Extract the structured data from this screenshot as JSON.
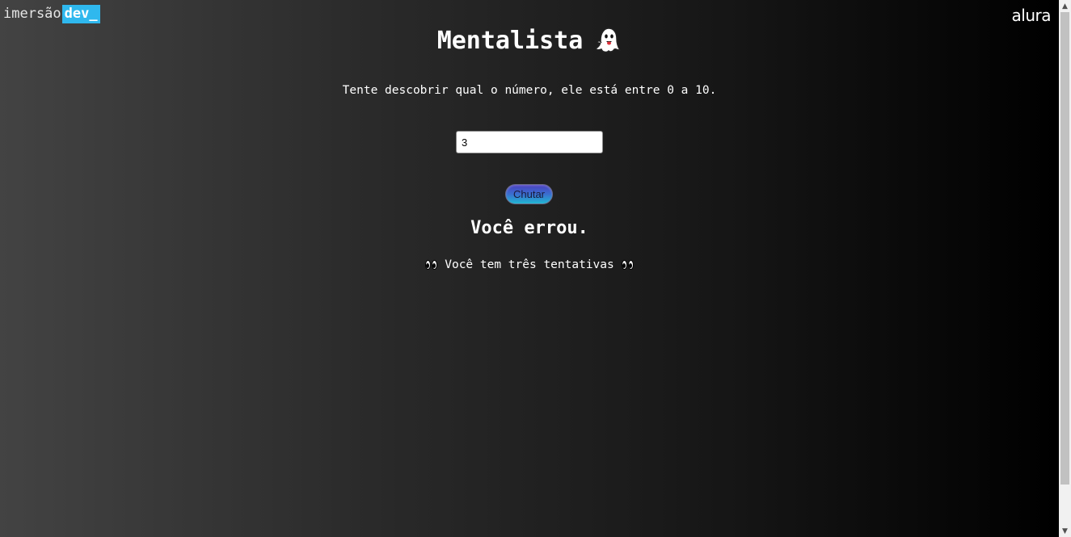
{
  "brand": {
    "imersao_text": "imersão",
    "dev_text": "dev_",
    "dev_color": "#2fb8ee",
    "alura_text": "alura"
  },
  "game": {
    "title": "Mentalista",
    "title_icon": "ghost-icon",
    "instruction": "Tente descobrir qual o número, ele está entre 0 a 10.",
    "input_value": "3",
    "button_label": "Chutar",
    "result_text": "Você errou.",
    "attempts_text": "Você tem três tentativas",
    "attempts_icon": "eyes-icon"
  },
  "scrollbar": {
    "up_glyph": "▲",
    "down_glyph": "▼"
  }
}
